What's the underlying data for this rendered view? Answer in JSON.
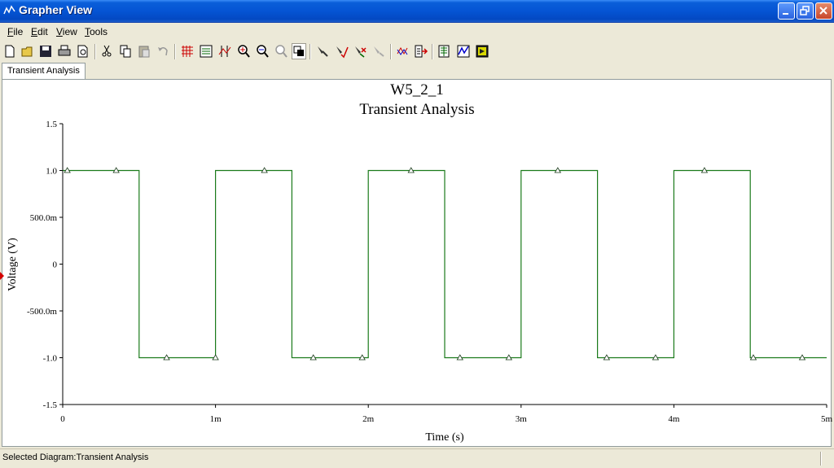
{
  "window": {
    "title": "Grapher View",
    "icon": "grapher-icon"
  },
  "menu": [
    {
      "label": "File",
      "accel": "F"
    },
    {
      "label": "Edit",
      "accel": "E"
    },
    {
      "label": "View",
      "accel": "V"
    },
    {
      "label": "Tools",
      "accel": "T"
    }
  ],
  "toolbar_icons": [
    "new-icon",
    "open-icon",
    "save-icon",
    "print-icon",
    "print-preview-icon",
    "cut-icon",
    "copy-icon",
    "paste-icon",
    "undo-icon",
    "grid-icon",
    "legend-icon",
    "cursors-icon",
    "zoom-in-icon",
    "zoom-out-icon",
    "zoom-full-icon",
    "reverse-colors-icon",
    "select-trace-icon",
    "add-marker-icon",
    "remove-marker-icon",
    "marker-off-icon",
    "overlay-traces-icon",
    "export-icon",
    "export-excel-icon",
    "export-measurement-icon",
    "labview-icon"
  ],
  "tabs": [
    {
      "label": "Transient Analysis",
      "active": true
    }
  ],
  "status": {
    "text": "Selected Diagram:Transient Analysis"
  },
  "colors": {
    "trace": "#1a7a1a",
    "axis": "#000000",
    "titlebar": "#0554d4"
  },
  "chart_data": {
    "type": "line",
    "title": "W5_2_1",
    "subtitle": "Transient Analysis",
    "xlabel": "Time (s)",
    "ylabel": "Voltage (V)",
    "xlim": [
      0,
      0.005
    ],
    "ylim": [
      -1.5,
      1.5
    ],
    "xticks": [
      {
        "v": 0,
        "label": "0"
      },
      {
        "v": 0.001,
        "label": "1m"
      },
      {
        "v": 0.002,
        "label": "2m"
      },
      {
        "v": 0.003,
        "label": "3m"
      },
      {
        "v": 0.004,
        "label": "4m"
      },
      {
        "v": 0.005,
        "label": "5m"
      }
    ],
    "yticks": [
      {
        "v": 1.5,
        "label": "1.5"
      },
      {
        "v": 1.0,
        "label": "1.0"
      },
      {
        "v": 0.5,
        "label": "500.0m"
      },
      {
        "v": 0,
        "label": "0"
      },
      {
        "v": -0.5,
        "label": "-500.0m"
      },
      {
        "v": -1.0,
        "label": "-1.0"
      },
      {
        "v": -1.5,
        "label": "-1.5"
      }
    ],
    "grid": false,
    "series": [
      {
        "color": "#1a7a1a",
        "marker": "triangle",
        "x": [
          0,
          0.0005,
          0.0005,
          0.001,
          0.001,
          0.0015,
          0.0015,
          0.002,
          0.002,
          0.0025,
          0.0025,
          0.003,
          0.003,
          0.0035,
          0.0035,
          0.004,
          0.004,
          0.0045,
          0.0045,
          0.005
        ],
        "y": [
          1,
          1,
          -1,
          -1,
          1,
          1,
          -1,
          -1,
          1,
          1,
          -1,
          -1,
          1,
          1,
          -1,
          -1,
          1,
          1,
          -1,
          -1
        ],
        "markers": [
          [
            3e-05,
            1
          ],
          [
            0.00035,
            1
          ],
          [
            0.00068,
            -1
          ],
          [
            0.001,
            -1
          ],
          [
            0.00132,
            1
          ],
          [
            0.00164,
            -1
          ],
          [
            0.00196,
            -1
          ],
          [
            0.00228,
            1
          ],
          [
            0.0026,
            -1
          ],
          [
            0.00292,
            -1
          ],
          [
            0.00324,
            1
          ],
          [
            0.00356,
            -1
          ],
          [
            0.00388,
            -1
          ],
          [
            0.0042,
            1
          ],
          [
            0.00452,
            -1
          ],
          [
            0.00484,
            -1
          ]
        ]
      }
    ]
  }
}
